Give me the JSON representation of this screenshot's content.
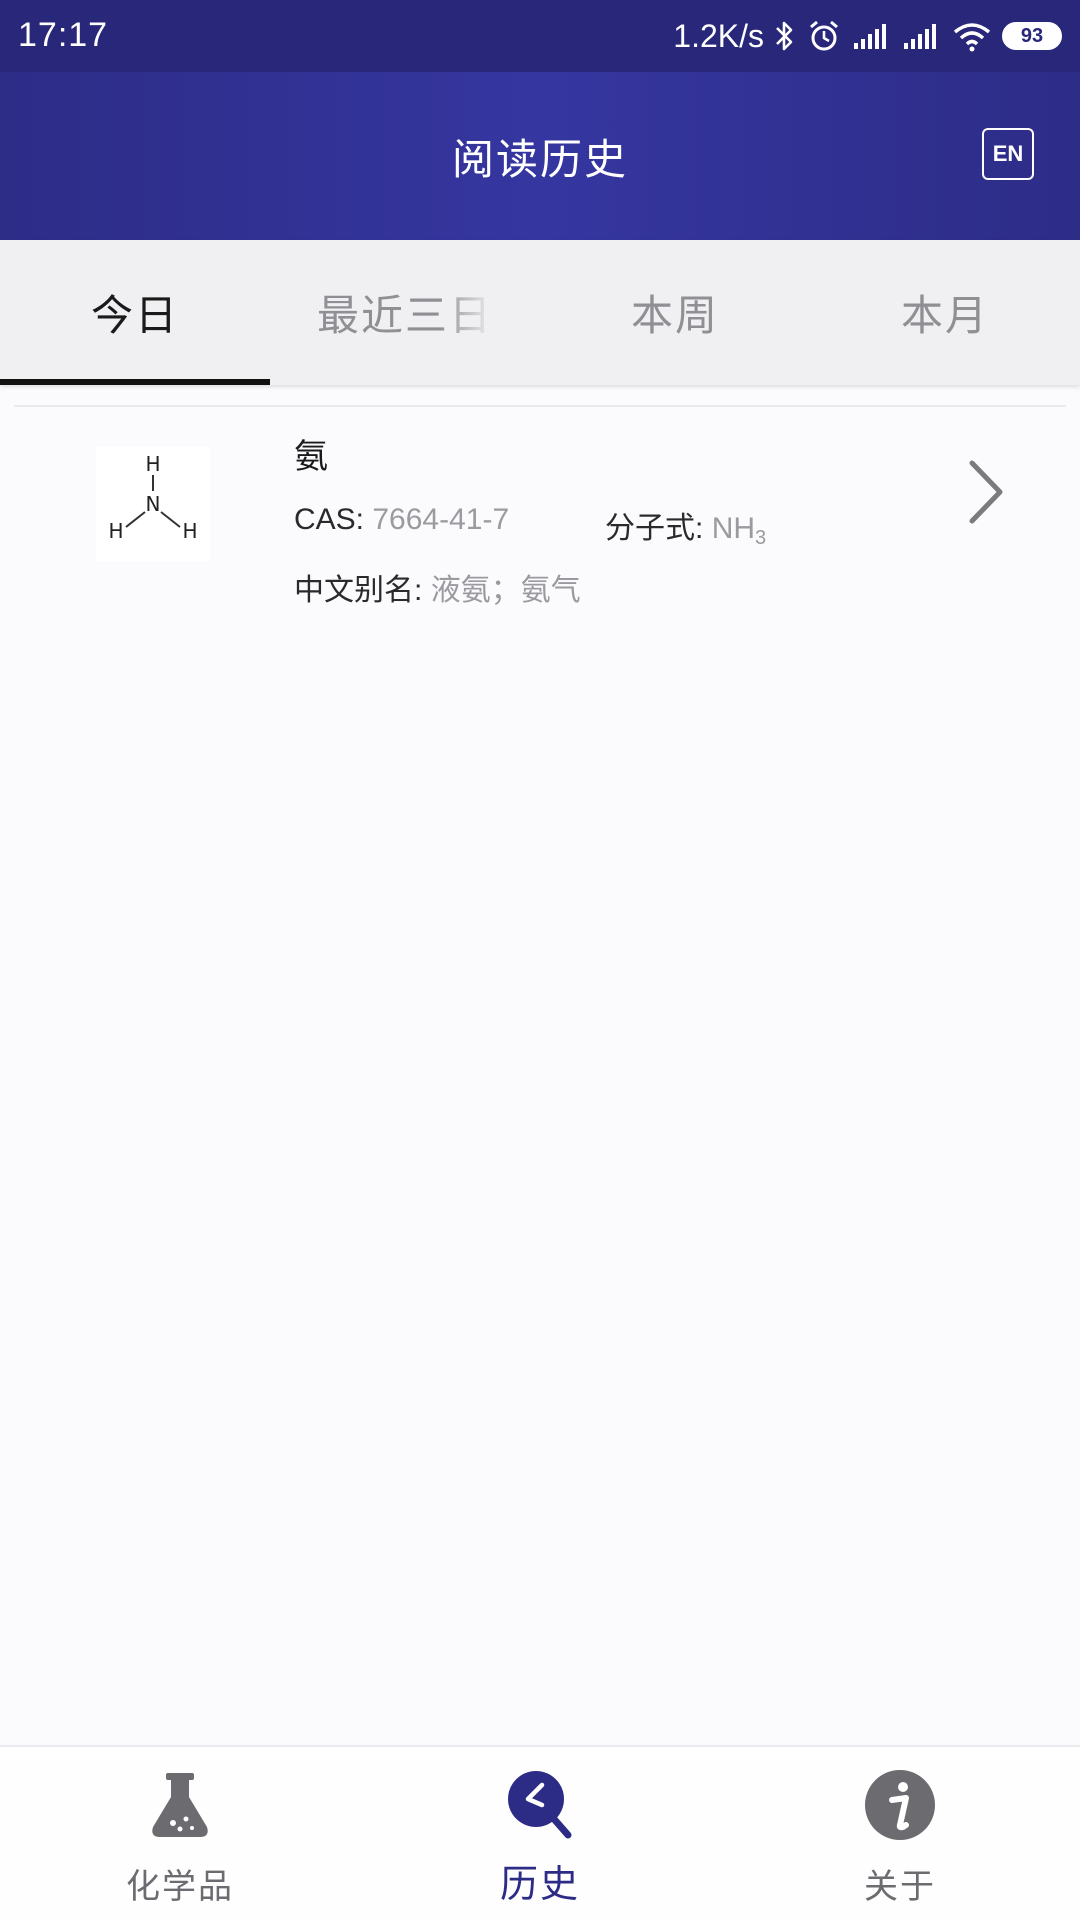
{
  "status_bar": {
    "time": "17:17",
    "speed": "1.2K/s",
    "battery": "93",
    "icons": [
      "bluetooth-icon",
      "alarm-icon",
      "signal-icon",
      "signal-icon",
      "wifi-icon",
      "battery-icon"
    ]
  },
  "app_bar": {
    "title": "阅读历史",
    "lang_button": "EN"
  },
  "tabs": [
    {
      "label": "今日",
      "active": true
    },
    {
      "label": "最近三日",
      "active": false
    },
    {
      "label": "本周",
      "active": false
    },
    {
      "label": "本月",
      "active": false
    }
  ],
  "history": [
    {
      "name": "氨",
      "cas_label": "CAS:",
      "cas_value": "7664-41-7",
      "formula_label": "分子式:",
      "formula_main": "NH",
      "formula_sub": "3",
      "alias_label": "中文别名:",
      "alias_value": "液氨；氨气",
      "structure": {
        "atoms": [
          "H",
          "N",
          "H",
          "H"
        ]
      }
    }
  ],
  "bottom_nav": [
    {
      "label": "化学品",
      "icon": "flask-icon",
      "active": false
    },
    {
      "label": "历史",
      "icon": "history-search-icon",
      "active": true
    },
    {
      "label": "关于",
      "icon": "info-icon",
      "active": false
    }
  ],
  "colors": {
    "primary": "#2d2c87",
    "status_bar": "#28277a",
    "tab_bg": "#f0f0f3",
    "muted": "#9a9a9f"
  }
}
